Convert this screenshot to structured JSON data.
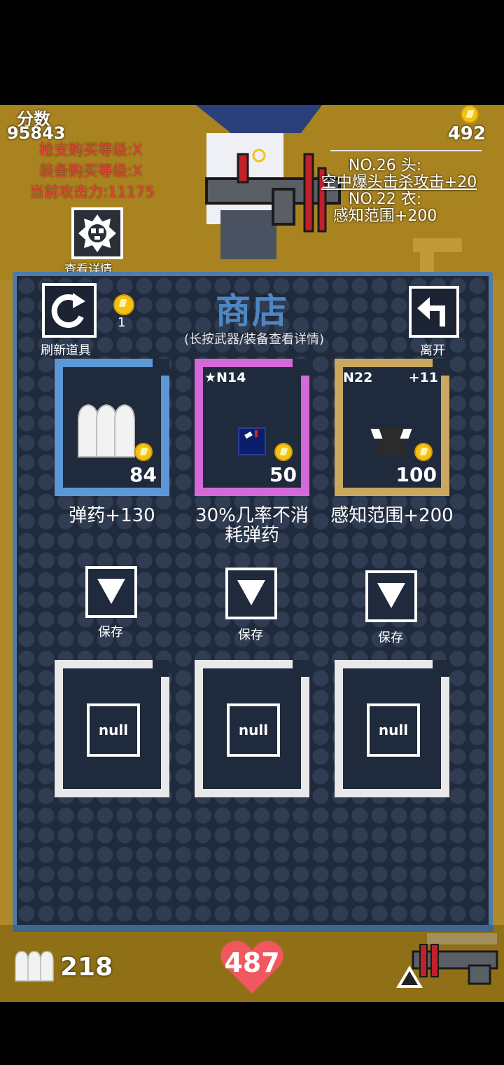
{
  "hud": {
    "score_label": "分数",
    "score": "95843",
    "gun_level": "枪支购买等级:X",
    "equip_level": "装备购买等级:X",
    "attack": "当前攻击力:11175",
    "coins": "492",
    "equip1_title": "NO.26 头:",
    "equip1_effect": "空中爆头击杀攻击+20",
    "equip2_title": "NO.22 衣:",
    "equip2_effect": "感知范围+200",
    "details_label": "查看详情"
  },
  "shop": {
    "title": "商店",
    "subtitle": "(长按武器/装备查看详情)",
    "refresh_label": "刷新道具",
    "refresh_cost": "1",
    "leave_label": "离开",
    "items": [
      {
        "price": "84",
        "desc": "弹药+130",
        "tag_left": "",
        "tag_right": "",
        "color": "#5d98d6"
      },
      {
        "price": "50",
        "desc_line1": "30%几率不消",
        "desc_line2": "耗弹药",
        "tag_left": "★N14",
        "tag_right": "",
        "color": "#d46ad8"
      },
      {
        "price": "100",
        "desc": "感知范围+200",
        "tag_left": "N22",
        "tag_right": "+11",
        "color": "#cba860"
      }
    ],
    "save_label": "保存",
    "slots": [
      "null",
      "null",
      "null"
    ]
  },
  "status": {
    "ammo": "218",
    "hp": "487"
  },
  "colors": {
    "panel_bg": "#1f2a3c",
    "panel_border": "#4d7cab",
    "title": "#4f86c3",
    "hud_red": "#e14a3a",
    "heart": "#f0575f",
    "coin": "#f3c214"
  },
  "icons": [
    "skull-icon",
    "refresh-icon",
    "back-arrow-icon",
    "coin-icon",
    "save-arrow-icon",
    "bullet-icon",
    "heart-icon",
    "swap-weapon-icon"
  ]
}
